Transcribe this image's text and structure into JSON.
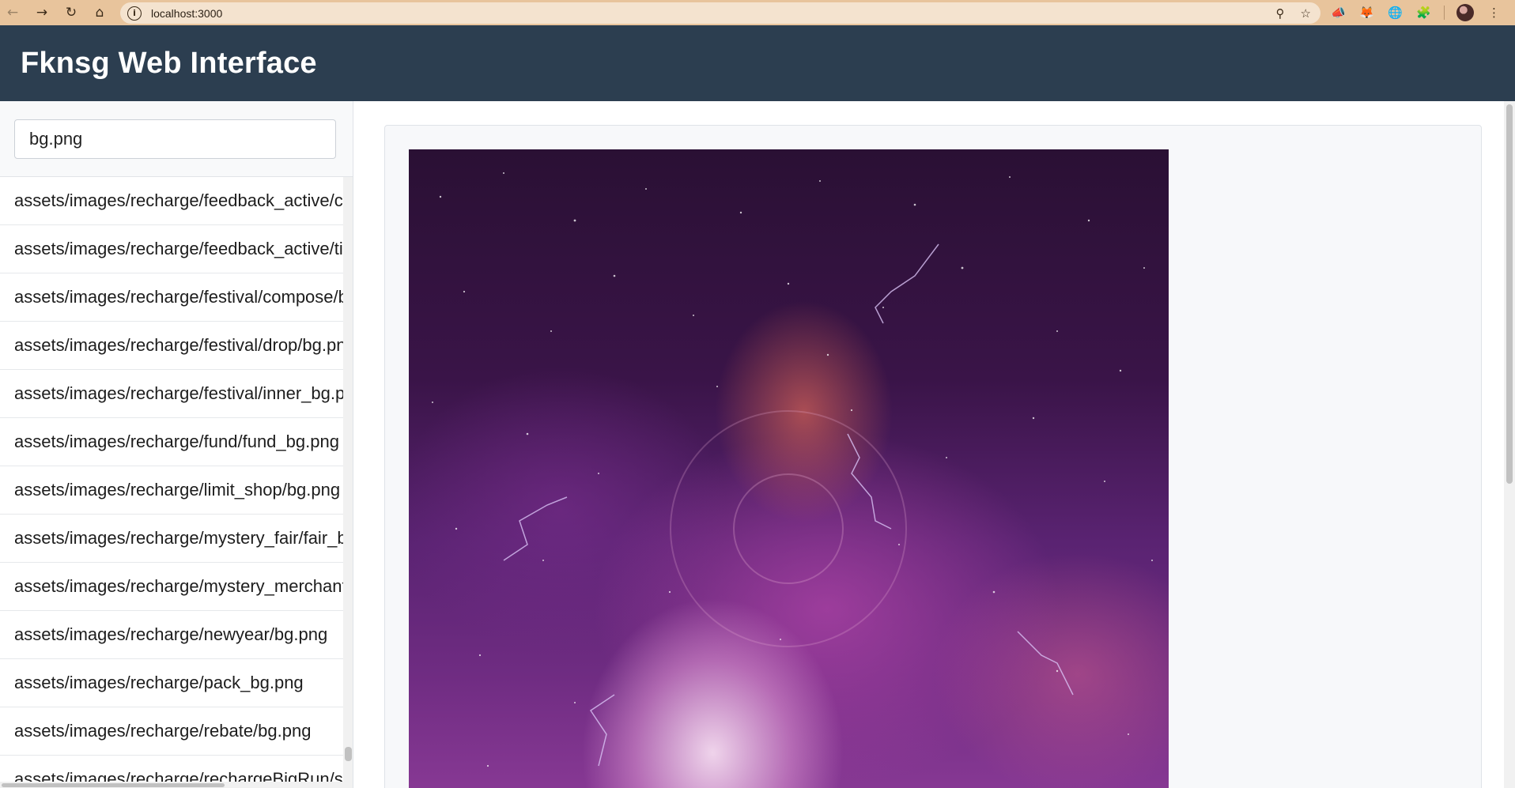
{
  "browser": {
    "url": "localhost:3000",
    "back_icon": "arrow-left-icon",
    "forward_icon": "arrow-right-icon",
    "reload_icon": "reload-icon",
    "home_icon": "home-icon"
  },
  "header": {
    "title": "Fknsg Web Interface",
    "background": "#2c3e50"
  },
  "sidebar": {
    "search": {
      "value": "bg.png"
    },
    "files": [
      "assets/images/recharge/feedback_active/com",
      "assets/images/recharge/feedback_active/tim",
      "assets/images/recharge/festival/compose/bg",
      "assets/images/recharge/festival/drop/bg.png",
      "assets/images/recharge/festival/inner_bg.png",
      "assets/images/recharge/fund/fund_bg.png",
      "assets/images/recharge/limit_shop/bg.png",
      "assets/images/recharge/mystery_fair/fair_bg.",
      "assets/images/recharge/mystery_merchant/b",
      "assets/images/recharge/newyear/bg.png",
      "assets/images/recharge/pack_bg.png",
      "assets/images/recharge/rebate/bg.png",
      "assets/images/recharge/rechargeBigRun/sta"
    ]
  },
  "preview": {
    "image_description_icon": "nebula-image"
  }
}
